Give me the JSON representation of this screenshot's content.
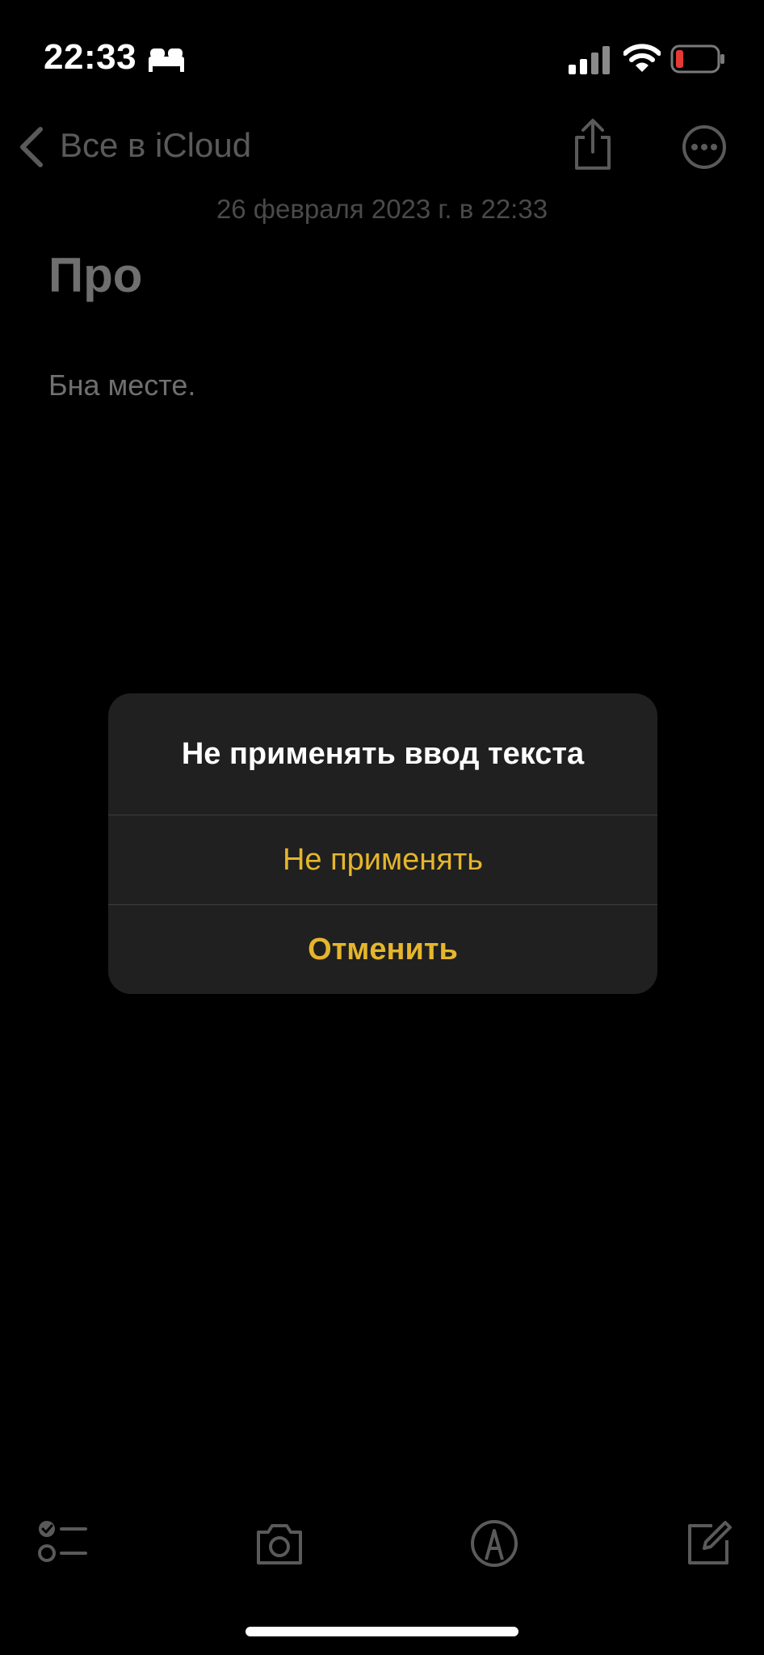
{
  "status_bar": {
    "time": "22:33",
    "icons": [
      "bed-icon",
      "cellular-signal-icon",
      "wifi-icon",
      "battery-low-icon"
    ],
    "battery_color": "#e53935"
  },
  "nav": {
    "back_label": "Все в iCloud",
    "icons": [
      "chevron-left-icon",
      "share-icon",
      "more-icon"
    ]
  },
  "note": {
    "date": "26 февраля 2023 г. в 22:33",
    "title": "Про",
    "body": "Бна месте."
  },
  "alert": {
    "title": "Не применять ввод текста",
    "actions": [
      {
        "label": "Не применять",
        "style": "default"
      },
      {
        "label": "Отменить",
        "style": "bold"
      }
    ]
  },
  "toolbar": {
    "icons": [
      "checklist-icon",
      "camera-icon",
      "markup-pen-icon",
      "compose-icon"
    ]
  },
  "colors": {
    "accent": "#e5b62c",
    "background": "#000000",
    "alert_background": "#202020",
    "dimmed_text": "#6f6f6f"
  }
}
